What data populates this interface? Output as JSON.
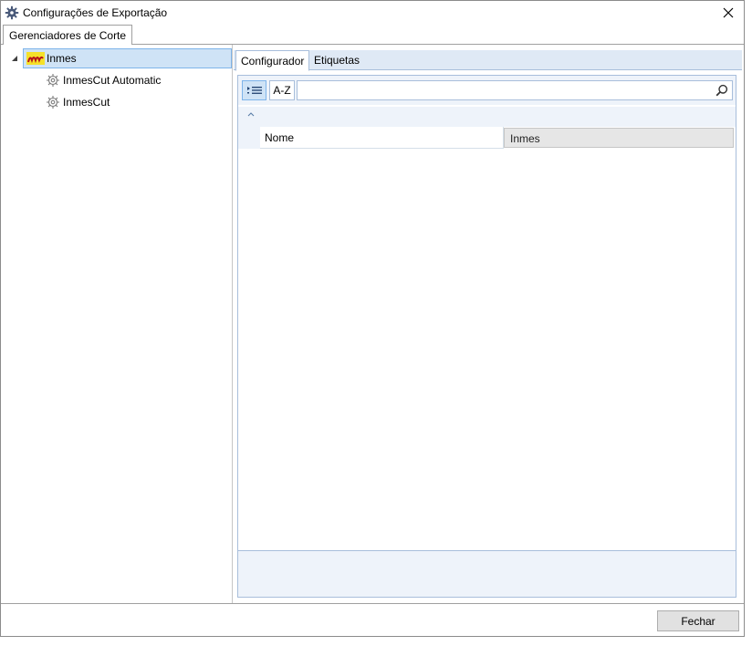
{
  "window": {
    "title": "Configurações de Exportação"
  },
  "outer_tabs": [
    {
      "label": "Gerenciadores de Corte"
    }
  ],
  "tree": {
    "root": {
      "label": "Inmes"
    },
    "children": [
      {
        "label": "InmesCut Automatic"
      },
      {
        "label": "InmesCut"
      }
    ]
  },
  "inner_tabs": [
    {
      "label": "Configurador",
      "active": true
    },
    {
      "label": "Etiquetas",
      "active": false
    }
  ],
  "toolbar": {
    "sort_alpha_label": "A-Z",
    "search_placeholder": ""
  },
  "properties": [
    {
      "name": "Nome",
      "value": "Inmes"
    }
  ],
  "footer": {
    "close_label": "Fechar"
  }
}
